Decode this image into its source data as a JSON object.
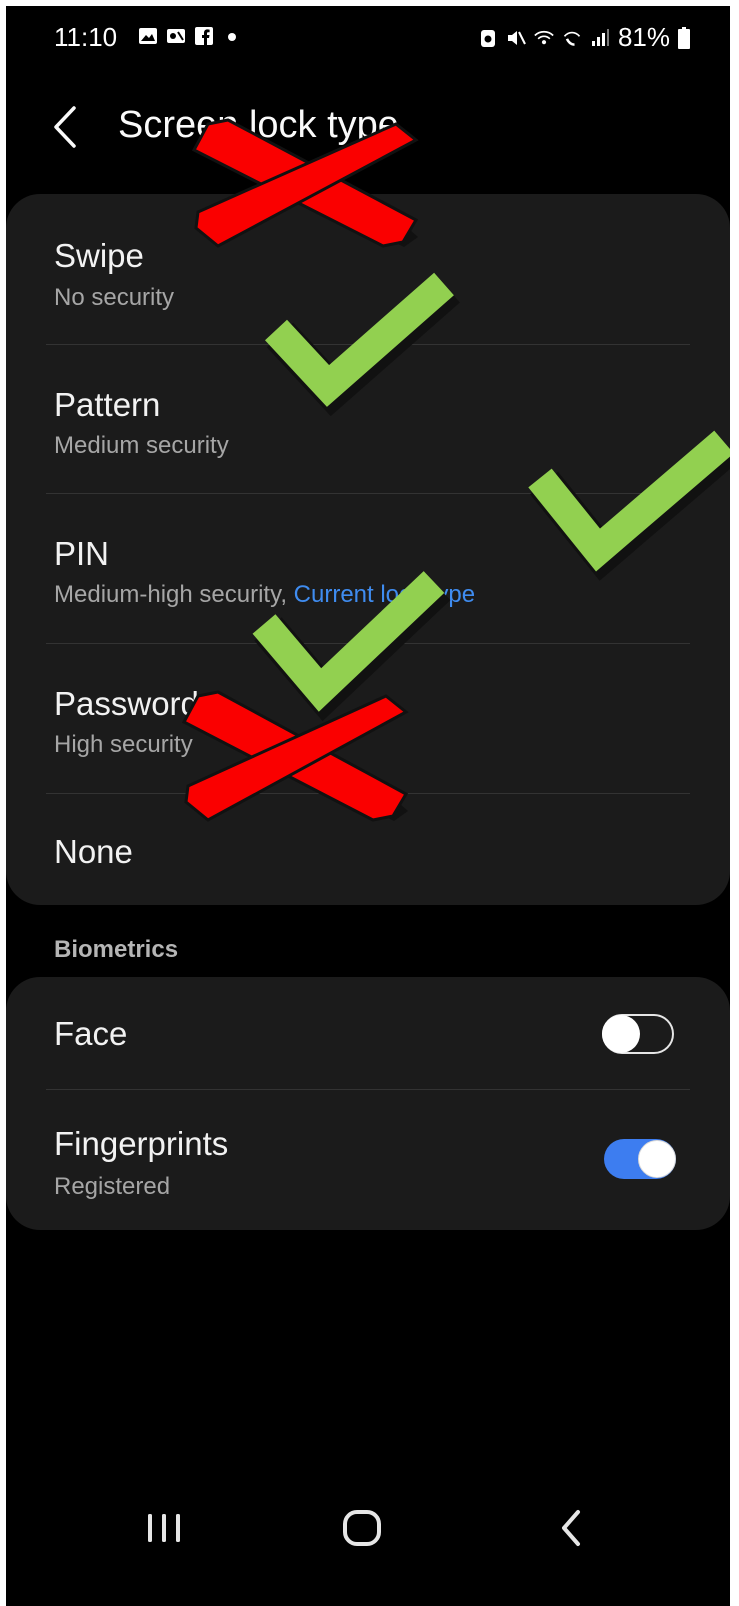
{
  "status_bar": {
    "time": "11:10",
    "battery": "81%",
    "icons": [
      "gallery-icon",
      "screen-recorder-icon",
      "facebook-icon",
      "dot-icon",
      "battery-saver-icon",
      "mute-icon",
      "wifi-icon",
      "wifi-calling-icon",
      "signal-icon",
      "battery-icon"
    ]
  },
  "header": {
    "title": "Screen lock type",
    "back_icon": "chevron-left-icon"
  },
  "lock_types": [
    {
      "title": "Swipe",
      "subtitle": "No security"
    },
    {
      "title": "Pattern",
      "subtitle": "Medium security"
    },
    {
      "title": "PIN",
      "subtitle": "Medium-high security",
      "subtitle_accent": "Current lock type",
      "separator": ", "
    },
    {
      "title": "Password",
      "subtitle": "High security"
    },
    {
      "title": "None"
    }
  ],
  "biometrics": {
    "section_label": "Biometrics",
    "items": [
      {
        "title": "Face",
        "enabled": false
      },
      {
        "title": "Fingerprints",
        "subtitle": "Registered",
        "enabled": true
      }
    ]
  },
  "overlay_marks": [
    "red-x-mark",
    "green-check-mark",
    "green-check-mark",
    "green-check-mark",
    "red-x-mark"
  ],
  "colors": {
    "background": "#000000",
    "card": "#1b1b1b",
    "accent_blue": "#3f8cf0",
    "toggle_on": "#3d7df0",
    "mark_red": "#fa0000",
    "mark_green": "#92d050"
  },
  "nav_bar": {
    "icons": [
      "recent-apps-icon",
      "home-icon",
      "back-icon"
    ]
  }
}
